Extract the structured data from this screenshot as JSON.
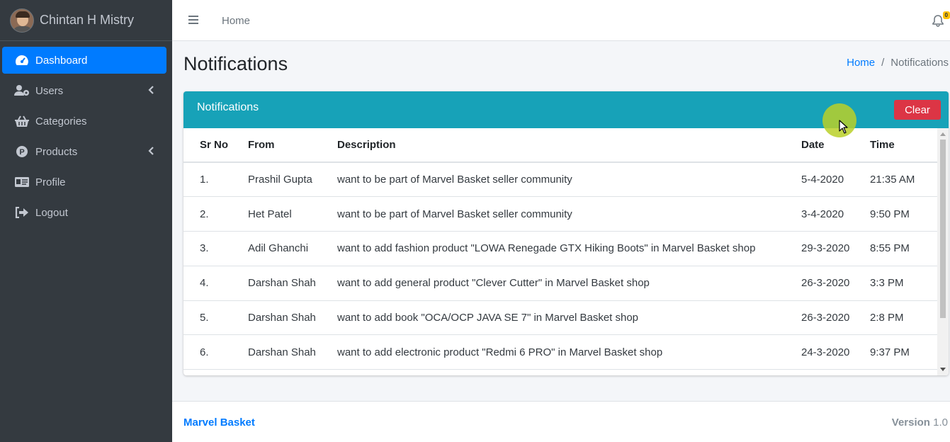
{
  "user": {
    "name": "Chintan H Mistry"
  },
  "sidebar": {
    "items": [
      {
        "label": "Dashboard",
        "icon": "tachometer-icon",
        "active": true
      },
      {
        "label": "Users",
        "icon": "users-cog-icon",
        "has_children": true
      },
      {
        "label": "Categories",
        "icon": "shopping-basket-icon"
      },
      {
        "label": "Products",
        "icon": "product-p-icon",
        "has_children": true
      },
      {
        "label": "Profile",
        "icon": "id-card-icon"
      },
      {
        "label": "Logout",
        "icon": "sign-out-icon"
      }
    ]
  },
  "topbar": {
    "home_label": "Home",
    "notification_badge": "0"
  },
  "page": {
    "title": "Notifications",
    "breadcrumb": {
      "home": "Home",
      "separator": "/",
      "current": "Notifications"
    }
  },
  "card": {
    "title": "Notifications",
    "clear_label": "Clear",
    "columns": [
      "Sr No",
      "From",
      "Description",
      "Date",
      "Time"
    ],
    "rows": [
      {
        "sr": "1.",
        "from": "Prashil Gupta",
        "description": "want to be part of Marvel Basket seller community",
        "date": "5-4-2020",
        "time": "21:35 AM"
      },
      {
        "sr": "2.",
        "from": "Het Patel",
        "description": "want to be part of Marvel Basket seller community",
        "date": "3-4-2020",
        "time": "9:50 PM"
      },
      {
        "sr": "3.",
        "from": "Adil Ghanchi",
        "description": "want to add fashion product \"LOWA Renegade GTX Hiking Boots\" in Marvel Basket shop",
        "date": "29-3-2020",
        "time": "8:55 PM"
      },
      {
        "sr": "4.",
        "from": "Darshan Shah",
        "description": "want to add general product \"Clever Cutter\" in Marvel Basket shop",
        "date": "26-3-2020",
        "time": "3:3 PM"
      },
      {
        "sr": "5.",
        "from": "Darshan Shah",
        "description": "want to add book \"OCA/OCP JAVA SE 7\" in Marvel Basket shop",
        "date": "26-3-2020",
        "time": "2:8 PM"
      },
      {
        "sr": "6.",
        "from": "Darshan Shah",
        "description": "want to add electronic product \"Redmi 6 PRO\" in Marvel Basket shop",
        "date": "24-3-2020",
        "time": "9:37 PM"
      }
    ]
  },
  "footer": {
    "brand": "Marvel Basket",
    "version_label": "Version",
    "version_number": "1.0"
  },
  "colors": {
    "sidebar": "#343a40",
    "active": "#007bff",
    "card_header": "#17a2b8",
    "clear": "#dc3545"
  }
}
